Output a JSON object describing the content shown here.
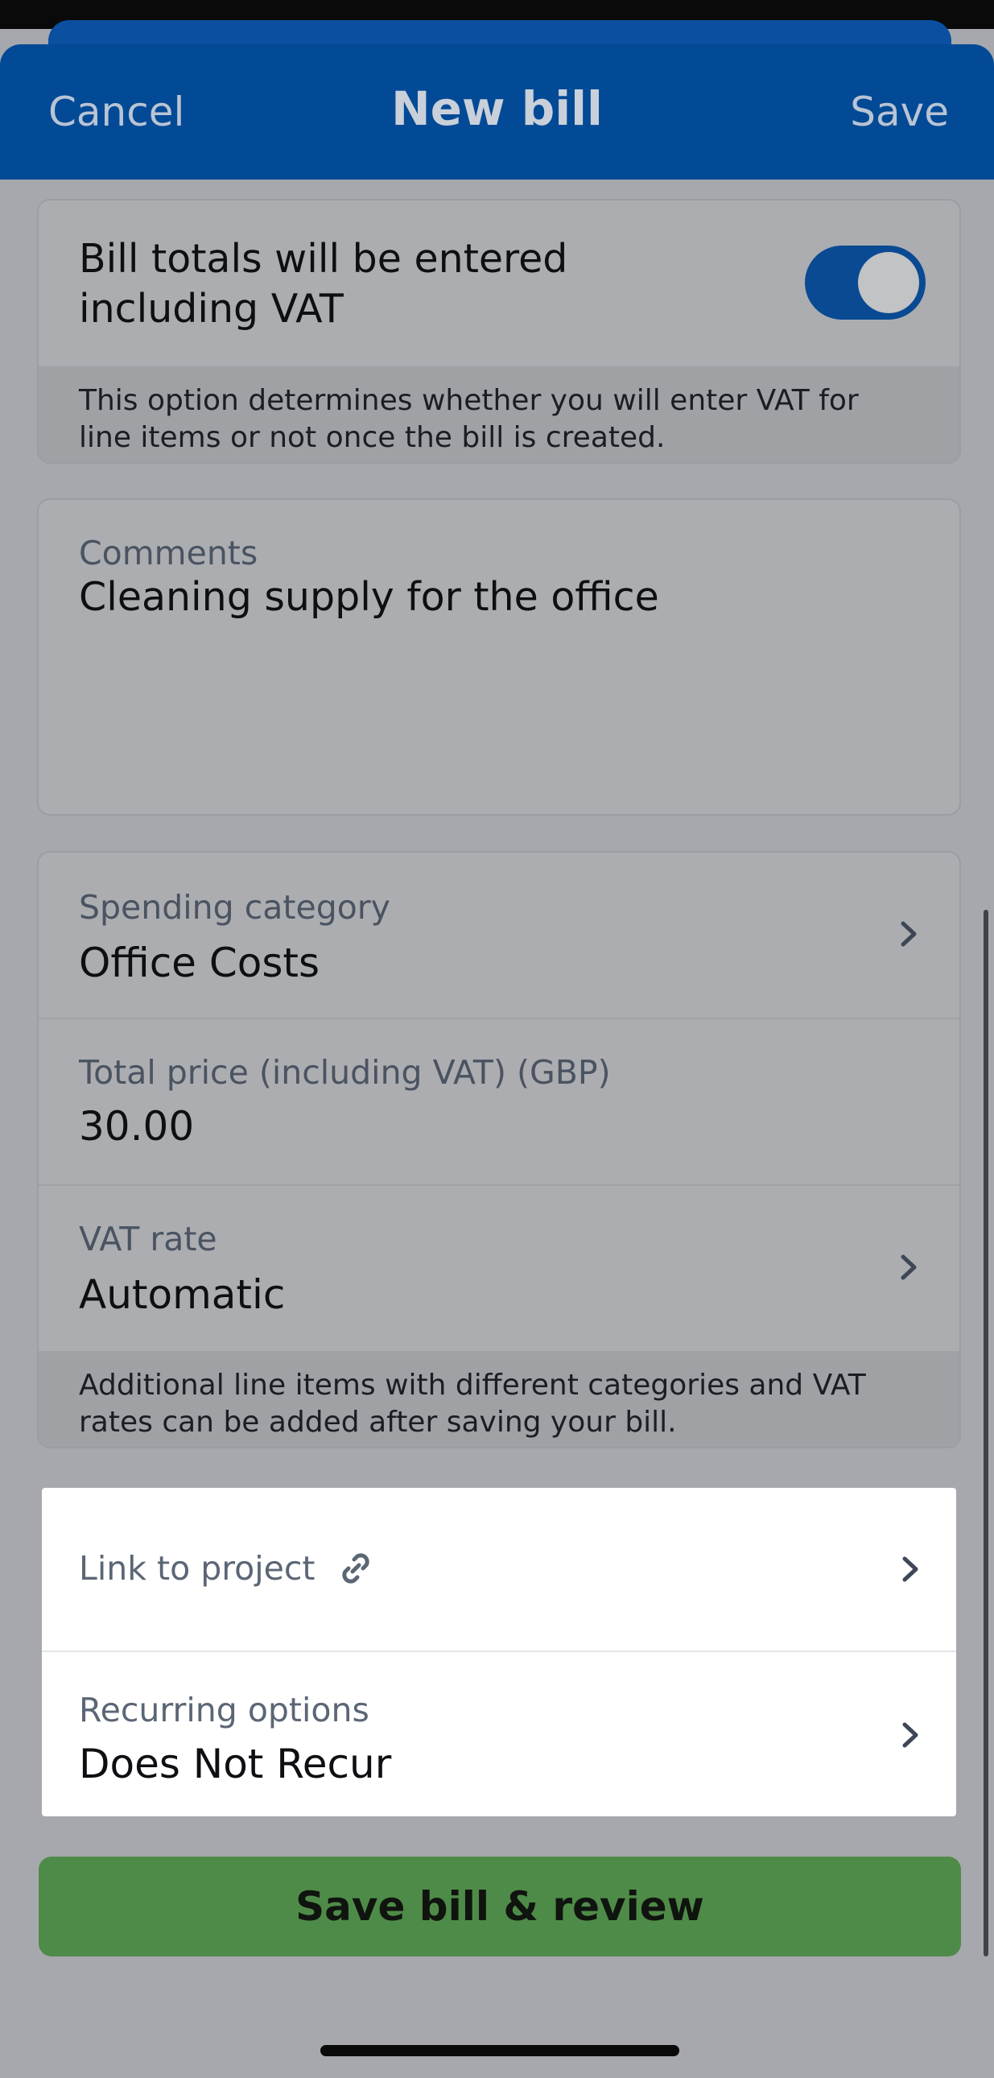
{
  "header": {
    "cancel_label": "Cancel",
    "title": "New bill",
    "save_label": "Save"
  },
  "vat_option": {
    "title": "Bill totals will be entered including VAT",
    "toggle_on": true,
    "note": "This option determines whether you will enter VAT for line items or not once the bill is created."
  },
  "comments": {
    "label": "Comments",
    "value": "Cleaning supply for the office"
  },
  "details": {
    "spending_category": {
      "label": "Spending category",
      "value": "Office Costs"
    },
    "total_price": {
      "label": "Total price (including VAT) (GBP)",
      "value": "30.00"
    },
    "vat_rate": {
      "label": "VAT rate",
      "value": "Automatic"
    },
    "note": "Additional line items with different categories and VAT rates can be added after saving your bill."
  },
  "extras": {
    "link_project": {
      "label": "Link to project"
    },
    "recurring": {
      "label": "Recurring options",
      "value": "Does Not Recur"
    }
  },
  "cta_label": "Save bill & review",
  "icons": {
    "chevron": "chevron-right-icon",
    "link": "link-icon"
  },
  "colors": {
    "header_bg": "#034a96",
    "toggle_on": "#094a93",
    "cta_bg": "#4f8b48"
  }
}
